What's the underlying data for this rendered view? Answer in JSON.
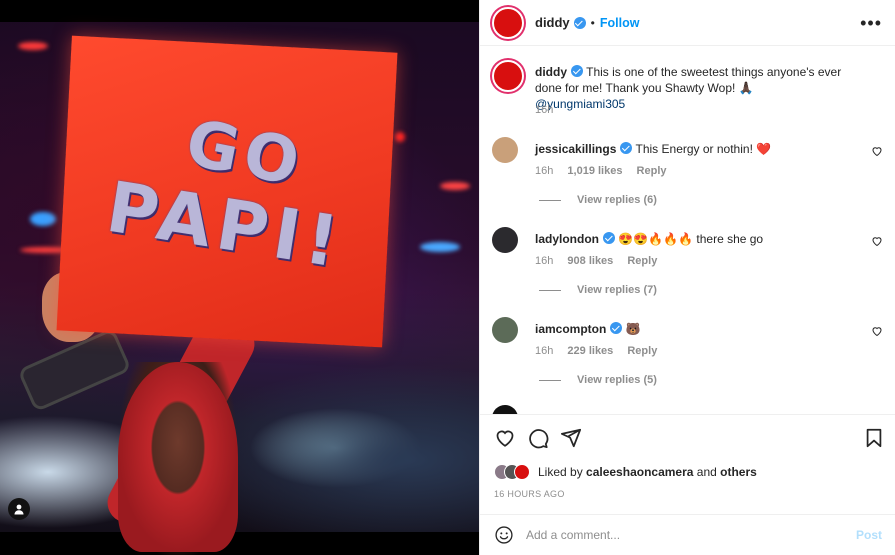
{
  "post": {
    "username": "diddy",
    "follow_label": "Follow",
    "separator": "•",
    "more_label": "•••"
  },
  "caption": {
    "username": "diddy",
    "text": "This is one of the sweetest things anyone's ever done for me! Thank you Shawty Wop! 🙏🏿 ",
    "mention": "@yungmiami305",
    "time": "16h"
  },
  "media": {
    "sign_line_1": "GO",
    "sign_line_2": "PAPI!"
  },
  "comments": [
    {
      "username": "jessicakillings",
      "text": "This Energy or nothin! ❤️",
      "time": "16h",
      "likes": "1,019 likes",
      "reply_label": "Reply",
      "view_replies": "View replies (6)",
      "avatar_color": "#c9a07a"
    },
    {
      "username": "ladylondon",
      "text": "😍😍🔥🔥🔥 there she go",
      "time": "16h",
      "likes": "908 likes",
      "reply_label": "Reply",
      "view_replies": "View replies (7)",
      "avatar_color": "#2b2a2e"
    },
    {
      "username": "iamcompton",
      "text": "🐻",
      "time": "16h",
      "likes": "229 likes",
      "reply_label": "Reply",
      "view_replies": "View replies (5)",
      "avatar_color": "#5c6b58"
    }
  ],
  "actions": {
    "liked_by_prefix": "Liked by ",
    "liked_by_user": "caleeshaoncamera",
    "liked_by_and": " and ",
    "liked_by_others": "others",
    "time_ago": "16 HOURS AGO"
  },
  "comment_box": {
    "placeholder": "Add a comment...",
    "post_label": "Post"
  },
  "colors": {
    "accent": "#0095f6",
    "verified": "#3897f0",
    "avatar_red": "#d80f0f"
  }
}
